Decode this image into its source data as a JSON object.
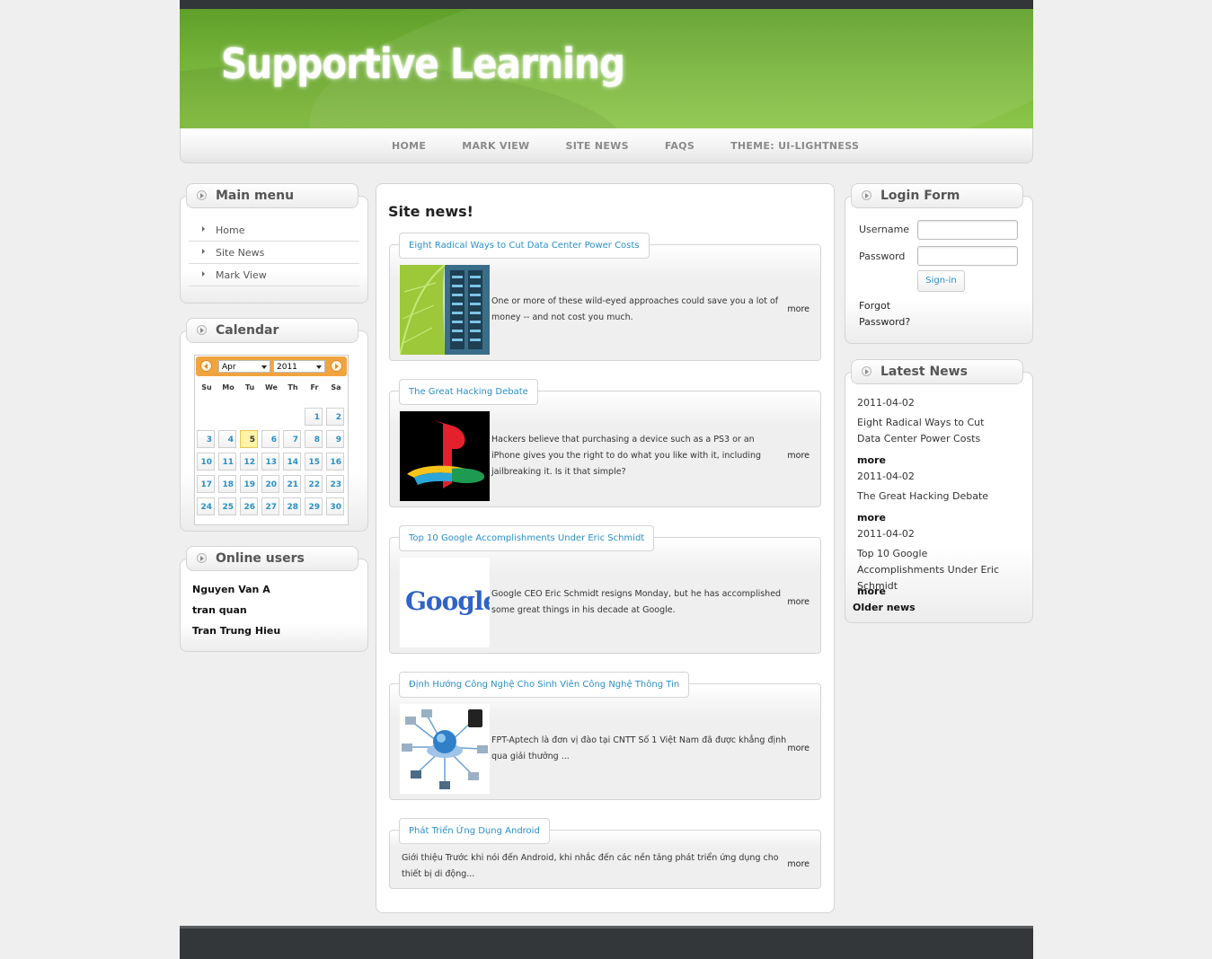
{
  "site": {
    "title": "Supportive Learning"
  },
  "nav": {
    "items": [
      "HOME",
      "MARK VIEW",
      "SITE NEWS",
      "FAQS",
      "THEME: UI-LIGHTNESS"
    ]
  },
  "main_menu": {
    "title": "Main menu",
    "items": [
      "Home",
      "Site News",
      "Mark View"
    ]
  },
  "calendar": {
    "title": "Calendar",
    "month": "Apr",
    "year": "2011",
    "weekdays": [
      "Su",
      "Mo",
      "Tu",
      "We",
      "Th",
      "Fr",
      "Sa"
    ],
    "today": "5",
    "weeks": [
      [
        "",
        "",
        "",
        "",
        "",
        "1",
        "2"
      ],
      [
        "3",
        "4",
        "5",
        "6",
        "7",
        "8",
        "9"
      ],
      [
        "10",
        "11",
        "12",
        "13",
        "14",
        "15",
        "16"
      ],
      [
        "17",
        "18",
        "19",
        "20",
        "21",
        "22",
        "23"
      ],
      [
        "24",
        "25",
        "26",
        "27",
        "28",
        "29",
        "30"
      ]
    ]
  },
  "online_users": {
    "title": "Online users",
    "users": [
      "Nguyen Van A",
      "tran quan",
      "Tran Trung Hieu"
    ]
  },
  "content": {
    "title": "Site news!",
    "articles": [
      {
        "title": "Eight Radical Ways to Cut Data Center Power Costs",
        "summary": "One or more of these wild-eyed approaches could save you a lot of money -- and not cost you much.",
        "more": "more",
        "image": "leaf-server-image"
      },
      {
        "title": "The Great Hacking Debate",
        "summary": "Hackers believe that purchasing a device such as a PS3 or an iPhone gives you the right to do what you like with it, including jailbreaking it. Is it that simple?",
        "more": "more",
        "image": "playstation-logo-image"
      },
      {
        "title": "Top 10 Google Accomplishments Under Eric Schmidt",
        "summary": "Google CEO Eric Schmidt resigns Monday, but he has accomplished some great things in his decade at Google.",
        "more": "more",
        "image": "google-logo-image",
        "logo_text": "Google"
      },
      {
        "title": "Định Hướng Công Nghệ Cho Sinh Viên Công Nghệ Thông Tin",
        "summary": "FPT-Aptech là đơn vị đào tại CNTT Số 1 Việt Nam đã được khẳng định qua giải thưởng ...",
        "more": "more",
        "image": "network-globe-image"
      },
      {
        "title": "Phát Triển Ứng Dụng Android",
        "summary": "Giới thiệu Trước khi nói đến Android, khi nhắc đến các nền tảng phát triển ứng dụng cho thiết bị di động...",
        "more": "more"
      }
    ]
  },
  "login": {
    "title": "Login Form",
    "username_label": "Username",
    "password_label": "Password",
    "username_value": "",
    "password_value": "",
    "signin_label": "Sign-in",
    "forgot_label": "Forgot Password?"
  },
  "latest_news": {
    "title": "Latest News",
    "items": [
      {
        "date": "2011-04-02",
        "title": "Eight Radical Ways to Cut Data Center Power Costs",
        "more": "more"
      },
      {
        "date": "2011-04-02",
        "title": "The Great Hacking Debate",
        "more": "more"
      },
      {
        "date": "2011-04-02",
        "title": "Top 10 Google Accomplishments Under Eric Schmidt",
        "more": "more"
      }
    ],
    "older": "Older news"
  },
  "colors": {
    "header_green": "#76b33a",
    "link_blue": "#2a8fc8",
    "calendar_orange": "#f0a440",
    "today_yellow": "#fff3a8",
    "footer_dark": "#343739"
  }
}
